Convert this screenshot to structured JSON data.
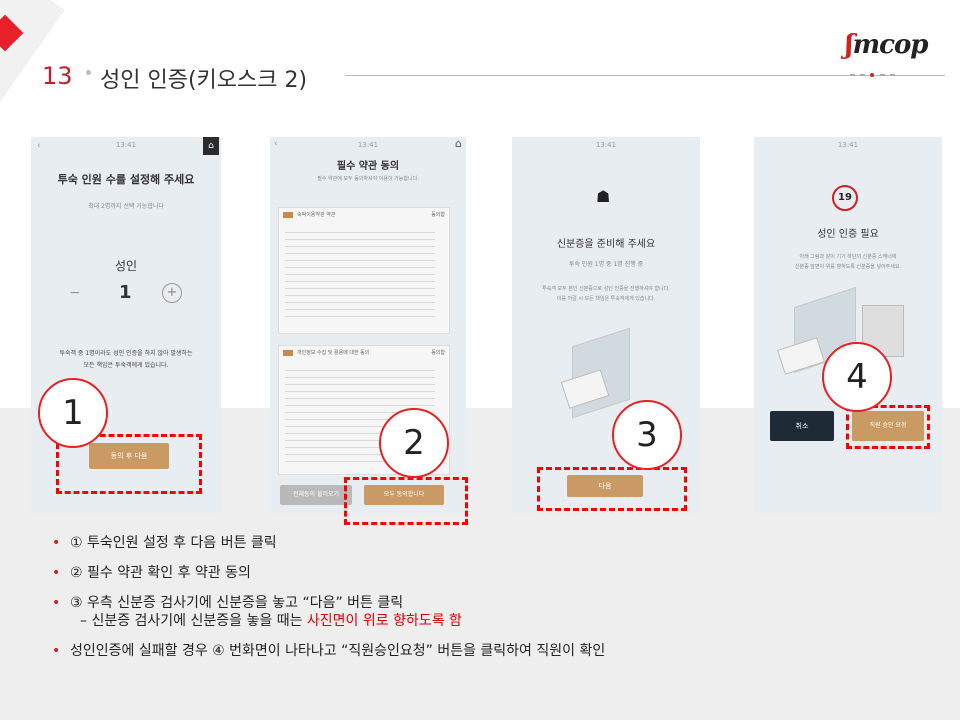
{
  "header": {
    "number": "13",
    "title": "성인 인증(키오스크 2)",
    "logo": "mcop"
  },
  "screens": [
    {
      "time": "13:41",
      "heading": "투숙 인원 수를 설정해 주세요",
      "sub": "최대 2명까지 선택 가능합니다",
      "label": "성인",
      "count": "1",
      "minus": "−",
      "plus": "+",
      "note1": "투숙객 중 1명이라도 성인 인증을 하지 않아 발생하는",
      "note2": "모든 책임은 투숙객에게 있습니다.",
      "button": "동의 후 다음"
    },
    {
      "time": "13:41",
      "heading": "필수 약관 동의",
      "sub": "필수 약관에 모두 동의하셔야 이용이 가능합니다.",
      "section1": "숙박이용약관 약관",
      "section2": "개인정보 수집 및 활용에 대한 동의",
      "agree": "동의함",
      "button_left": "전체동의 불러오기",
      "button_right": "모두 동의합니다"
    },
    {
      "time": "13:41",
      "heading": "신분증을 준비해 주세요",
      "sub": "투숙 인원 1명 중 1명 진행 중",
      "note1": "투숙객 모두 본인 신분증으로 성인 인증을 진행하셔야 합니다.",
      "note2": "이를 어길 시 모든 책임은 투숙객에게 있습니다.",
      "button": "다음"
    },
    {
      "time": "13:41",
      "badge": "19",
      "heading": "성인 인증 필요",
      "sub1": "아래 그림과 같이 기기 하단의 신분증 스캐너에",
      "sub2": "신분증 앞면이 위를 향하도록 신분증을 넣어주세요.",
      "button_cancel": "취소",
      "button_staff": "직원 승인 요청"
    }
  ],
  "callouts": [
    "1",
    "2",
    "3",
    "4"
  ],
  "bullets": {
    "b1": "① 투숙인원 설정 후 다음 버튼 클릭",
    "b2": "② 필수 약관 확인 후 약관 동의",
    "b3": "③ 우측 신분증 검사기에 신분증을 놓고 “다음” 버튼 클릭",
    "b3_sub_prefix": "– 신분증 검사기에 신분증을 놓을 때는 ",
    "b3_sub_highlight": "사진면이 위로 향하도록 함",
    "b4": "성인인증에 실패할 경우 ④ 번화면이 나타나고 “직원승인요청” 버튼을 클릭하여 직원이 확인",
    "marker": "•"
  },
  "colors": {
    "accent": "#e8202a",
    "dash": "#ff0000",
    "button": "#c99a63"
  }
}
